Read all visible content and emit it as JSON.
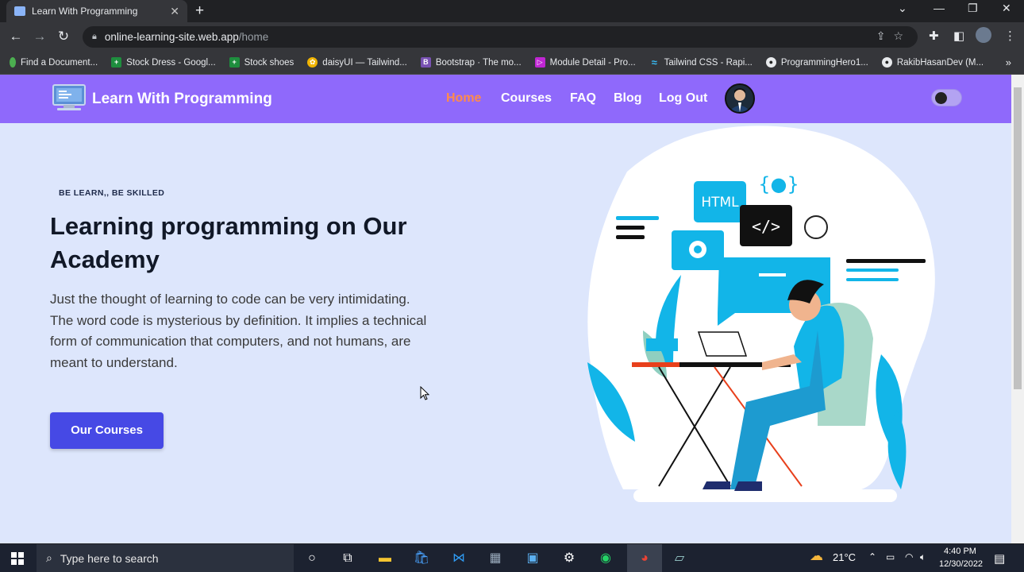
{
  "browser": {
    "tab_title": "Learn With Programming",
    "new_tab": "+",
    "url_host": "online-learning-site.web.app",
    "url_path": "/home",
    "bookmarks": [
      {
        "label": "Find a Document...",
        "color": "#4caf50",
        "glyph": ""
      },
      {
        "label": "Stock Dress - Googl...",
        "color": "#1e8e3e",
        "glyph": "+"
      },
      {
        "label": "Stock shoes",
        "color": "#1e8e3e",
        "glyph": "+"
      },
      {
        "label": "daisyUI — Tailwind...",
        "color": "#f0b400",
        "glyph": "✿"
      },
      {
        "label": "Bootstrap · The mo...",
        "color": "#7952b3",
        "glyph": "B"
      },
      {
        "label": "Module Detail - Pro...",
        "color": "#c026d3",
        "glyph": "▷"
      },
      {
        "label": "Tailwind CSS - Rapi...",
        "color": "#38bdf8",
        "glyph": "≈"
      },
      {
        "label": "ProgrammingHero1...",
        "color": "#333333",
        "glyph": "●"
      },
      {
        "label": "RakibHasanDev (M...",
        "color": "#333333",
        "glyph": "●"
      }
    ],
    "overflow": "»"
  },
  "site": {
    "brand": "Learn With Programming",
    "nav": {
      "home": "Home",
      "courses": "Courses",
      "faq": "FAQ",
      "blog": "Blog",
      "logout": "Log Out"
    },
    "colors": {
      "navbar": "#8f69fb",
      "active": "#ff8a4c",
      "cta": "#4649e5",
      "page_bg": "#dde6fc"
    }
  },
  "hero": {
    "eyebrow": "BE LEARN,, BE SKILLED",
    "headline": "Learning programming on Our Academy",
    "paragraph": "Just the thought of learning to code can be very intimidating. The word code is mysterious by definition. It implies a technical form of communication that computers, and not humans, are meant to understand.",
    "cta": "Our Courses",
    "illustration": {
      "html_badge": "HTML",
      "code_badge": "</>",
      "braces_badge": "{●}"
    }
  },
  "taskbar": {
    "search_placeholder": "Type here to search",
    "weather": "21°C",
    "time": "4:40 PM",
    "date": "12/30/2022"
  }
}
